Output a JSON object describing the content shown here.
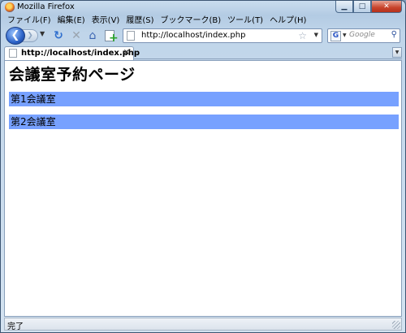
{
  "window": {
    "title": "Mozilla Firefox"
  },
  "menu": {
    "items": [
      "ファイル(F)",
      "編集(E)",
      "表示(V)",
      "履歴(S)",
      "ブックマーク(B)",
      "ツール(T)",
      "ヘルプ(H)"
    ]
  },
  "navbar": {
    "url": "http://localhost/index.php",
    "search_placeholder": "Google"
  },
  "tabs": [
    {
      "label": "http://localhost/index.php",
      "active": true
    }
  ],
  "page": {
    "title": "会議室予約ページ",
    "rooms": [
      "第1会議室",
      "第2会議室"
    ],
    "room_bg_color": "#77a1ff"
  },
  "status": {
    "text": "完了"
  }
}
